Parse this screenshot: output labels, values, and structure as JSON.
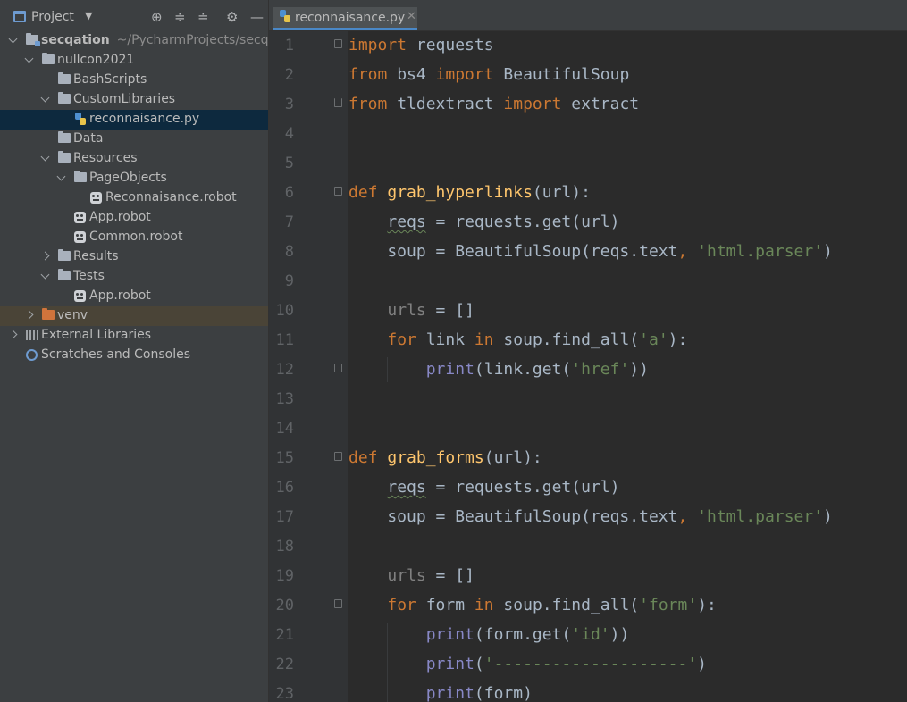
{
  "sidebar": {
    "title": "Project",
    "tree": [
      {
        "label": "secqation",
        "path": "~/PycharmProjects/secqat"
      },
      {
        "label": "nullcon2021"
      },
      {
        "label": "BashScripts"
      },
      {
        "label": "CustomLibraries"
      },
      {
        "label": "reconnaisance.py"
      },
      {
        "label": "Data"
      },
      {
        "label": "Resources"
      },
      {
        "label": "PageObjects"
      },
      {
        "label": "Reconnaisance.robot"
      },
      {
        "label": "App.robot"
      },
      {
        "label": "Common.robot"
      },
      {
        "label": "Results"
      },
      {
        "label": "Tests"
      },
      {
        "label": "App.robot"
      },
      {
        "label": "venv"
      },
      {
        "label": "External Libraries"
      },
      {
        "label": "Scratches and Consoles"
      }
    ]
  },
  "editor": {
    "tab": {
      "label": "reconnaisance.py"
    },
    "line_numbers": [
      "1",
      "2",
      "3",
      "4",
      "5",
      "6",
      "7",
      "8",
      "9",
      "10",
      "11",
      "12",
      "13",
      "14",
      "15",
      "16",
      "17",
      "18",
      "19",
      "20",
      "21",
      "22",
      "23"
    ],
    "lines": {
      "l1": {
        "a": "import",
        "b": " requests"
      },
      "l2": {
        "a": "from",
        "b": " bs4 ",
        "c": "import",
        "d": " BeautifulSoup"
      },
      "l3": {
        "a": "from",
        "b": " tldextract ",
        "c": "import",
        "d": " extract"
      },
      "l6": {
        "a": "def",
        "b": " ",
        "c": "grab_hyperlinks",
        "d": "(url):"
      },
      "l7": {
        "a": "    ",
        "b": "reqs",
        "c": " = requests.get(url)"
      },
      "l8": {
        "a": "    soup = BeautifulSoup(reqs.text",
        "b": ",",
        "c": " ",
        "d": "'html.parser'",
        "e": ")"
      },
      "l10": {
        "a": "    ",
        "b": "urls",
        "c": " = []"
      },
      "l11": {
        "a": "    ",
        "b": "for",
        "c": " link ",
        "d": "in",
        "e": " soup.find_all(",
        "f": "'a'",
        "g": "):"
      },
      "l12": {
        "a": "        ",
        "b": "print",
        "c": "(link.get(",
        "d": "'href'",
        "e": "))"
      },
      "l15": {
        "a": "def",
        "b": " ",
        "c": "grab_forms",
        "d": "(url):"
      },
      "l16": {
        "a": "    ",
        "b": "reqs",
        "c": " = requests.get(url)"
      },
      "l17": {
        "a": "    soup = BeautifulSoup(reqs.text",
        "b": ",",
        "c": " ",
        "d": "'html.parser'",
        "e": ")"
      },
      "l19": {
        "a": "    ",
        "b": "urls",
        "c": " = []"
      },
      "l20": {
        "a": "    ",
        "b": "for",
        "c": " form ",
        "d": "in",
        "e": " soup.find_all(",
        "f": "'form'",
        "g": "):"
      },
      "l21": {
        "a": "        ",
        "b": "print",
        "c": "(form.get(",
        "d": "'id'",
        "e": "))"
      },
      "l22": {
        "a": "        ",
        "b": "print",
        "c": "(",
        "d": "'--------------------'",
        "e": ")"
      },
      "l23": {
        "a": "        ",
        "b": "print",
        "c": "(form)"
      }
    }
  }
}
